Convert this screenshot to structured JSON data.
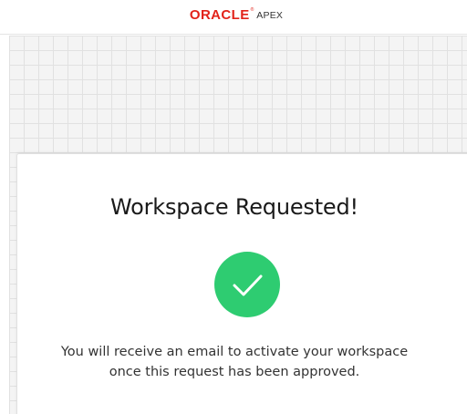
{
  "header": {
    "logo_brand": "ORACLE",
    "logo_registered": "®",
    "logo_product": "APEX"
  },
  "card": {
    "title": "Workspace Requested!",
    "status_icon": "checkmark-circle-icon",
    "message_line1": "You will receive an email to activate your workspace",
    "message_line2": "once this request has been approved."
  },
  "colors": {
    "brand_red": "#e2231a",
    "success_green": "#2ecc71",
    "grid_background": "#f4f4f4",
    "grid_lines": "#e1e1e1",
    "text": "#333333"
  }
}
